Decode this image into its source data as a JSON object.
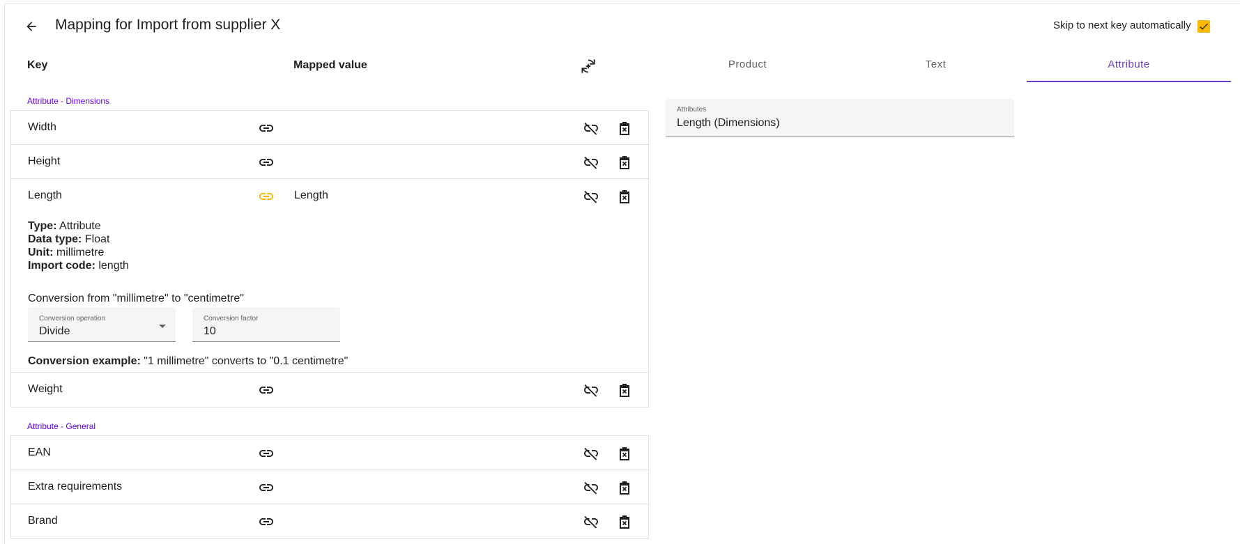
{
  "header": {
    "title": "Mapping for Import from supplier X",
    "skip_label": "Skip to next key automatically",
    "skip_checked": true
  },
  "columns": {
    "key": "Key",
    "mapped_value": "Mapped value"
  },
  "tabs": [
    {
      "label": "Product",
      "active": false
    },
    {
      "label": "Text",
      "active": false
    },
    {
      "label": "Attribute",
      "active": true
    }
  ],
  "groups": [
    {
      "label": "Attribute - Dimensions",
      "rows": [
        {
          "key": "Width",
          "mapped": "",
          "linked": false
        },
        {
          "key": "Height",
          "mapped": "",
          "linked": false
        },
        {
          "key": "Length",
          "mapped": "Length",
          "linked": true
        },
        {
          "key": "Weight",
          "mapped": "",
          "linked": false
        }
      ]
    },
    {
      "label": "Attribute - General",
      "rows": [
        {
          "key": "EAN",
          "mapped": "",
          "linked": false
        },
        {
          "key": "Extra requirements",
          "mapped": "",
          "linked": false
        },
        {
          "key": "Brand",
          "mapped": "",
          "linked": false
        }
      ]
    }
  ],
  "details": {
    "type_label": "Type:",
    "type_value": "Attribute",
    "datatype_label": "Data type:",
    "datatype_value": "Float",
    "unit_label": "Unit:",
    "unit_value": "millimetre",
    "importcode_label": "Import code:",
    "importcode_value": "length",
    "conversion_title": "Conversion from \"millimetre\" to \"centimetre\"",
    "operation_label": "Conversion operation",
    "operation_value": "Divide",
    "factor_label": "Conversion factor",
    "factor_value": "10",
    "example_label": "Conversion example:",
    "example_value": "\"1 millimetre\" converts to \"0.1 centimetre\""
  },
  "attribute_field": {
    "label": "Attributes",
    "value": "Length (Dimensions)"
  },
  "colors": {
    "accent": "#6a3ec5",
    "group_label": "#6200ea",
    "linked_icon": "#f9b800",
    "checkbox": "#f9b800"
  },
  "icons": {
    "back": "arrow-left-icon",
    "auto_map": "auto-map-icon",
    "link": "link-icon",
    "unlink": "link-off-icon",
    "delete": "delete-box-icon",
    "check": "check-icon"
  }
}
